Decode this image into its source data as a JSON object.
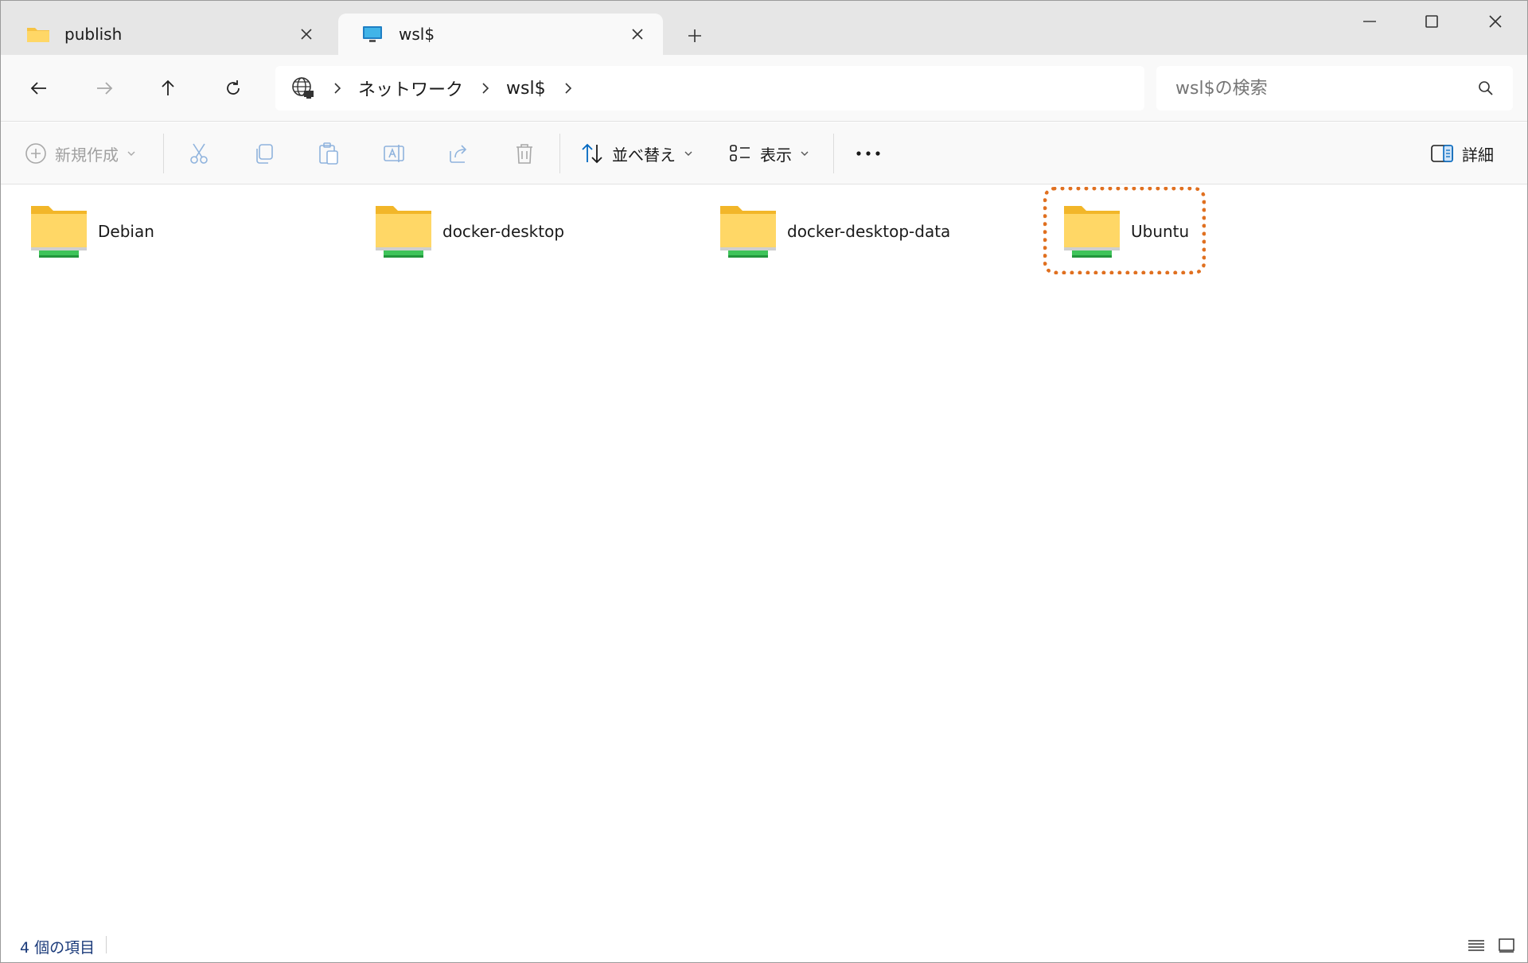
{
  "tabs": [
    {
      "label": "publish",
      "icon": "folder-icon"
    },
    {
      "label": "wsl$",
      "icon": "monitor-icon"
    }
  ],
  "address": {
    "root_icon": "network-icon",
    "crumbs": [
      "ネットワーク",
      "wsl$"
    ]
  },
  "search": {
    "placeholder": "wsl$の検索"
  },
  "commands": {
    "new_label": "新規作成",
    "sort_label": "並べ替え",
    "view_label": "表示",
    "details_label": "詳細"
  },
  "items": [
    {
      "name": "Debian",
      "icon": "network-folder-icon"
    },
    {
      "name": "docker-desktop",
      "icon": "network-folder-icon"
    },
    {
      "name": "docker-desktop-data",
      "icon": "network-folder-icon"
    },
    {
      "name": "Ubuntu",
      "icon": "network-folder-icon",
      "highlighted": true
    }
  ],
  "status": {
    "count_text": "4 個の項目"
  },
  "colors": {
    "accent": "#0067c0",
    "highlight": "#e07020",
    "folder_yellow": "#f6c344",
    "share_green": "#3ec45a"
  }
}
